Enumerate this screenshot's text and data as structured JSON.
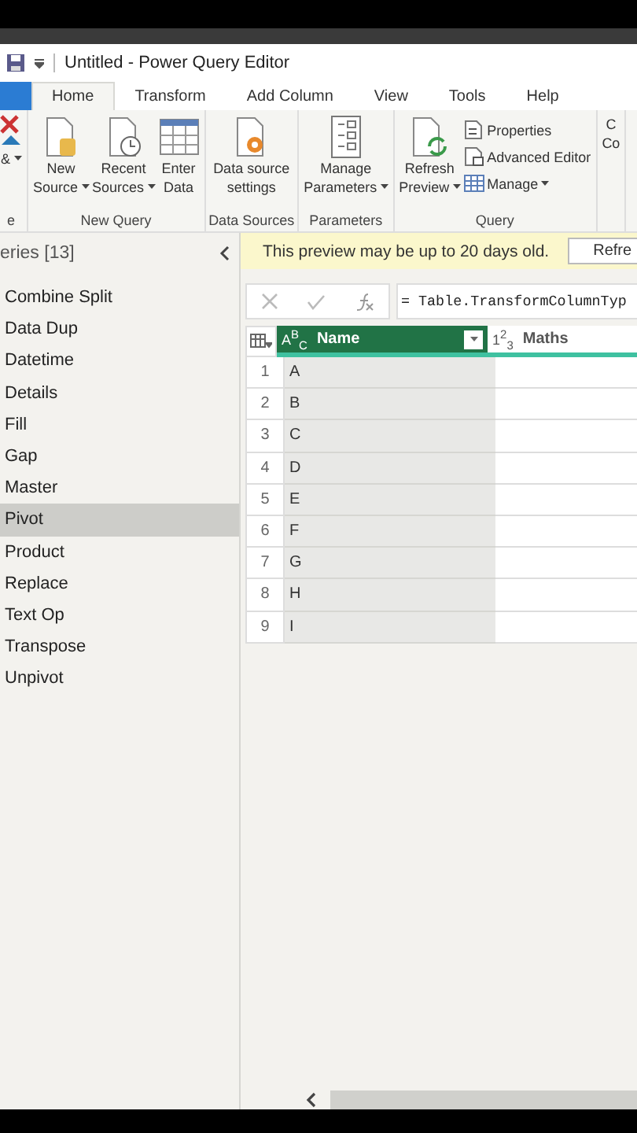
{
  "window": {
    "title": "Untitled - Power Query Editor"
  },
  "tabs": [
    {
      "label": "Home",
      "selected": true
    },
    {
      "label": "Transform",
      "selected": false
    },
    {
      "label": "Add Column",
      "selected": false
    },
    {
      "label": "View",
      "selected": false
    },
    {
      "label": "Tools",
      "selected": false
    },
    {
      "label": "Help",
      "selected": false
    }
  ],
  "ribbon": [
    {
      "label": "e",
      "buttons": [
        {
          "kind": "large",
          "lines": [
            "&"
          ],
          "dropdown": true
        }
      ]
    },
    {
      "label": "New Query",
      "buttons": [
        {
          "kind": "large",
          "lines": [
            "New",
            "Source"
          ],
          "dropdown": true
        },
        {
          "kind": "large",
          "lines": [
            "Recent",
            "Sources"
          ],
          "dropdown": true
        },
        {
          "kind": "large",
          "lines": [
            "Enter",
            "Data"
          ],
          "dropdown": false
        }
      ]
    },
    {
      "label": "Data Sources",
      "buttons": [
        {
          "kind": "large",
          "lines": [
            "Data source",
            "settings"
          ],
          "dropdown": false
        }
      ]
    },
    {
      "label": "Parameters",
      "buttons": [
        {
          "kind": "large",
          "lines": [
            "Manage",
            "Parameters"
          ],
          "dropdown": true
        }
      ]
    },
    {
      "label": "Query",
      "buttons": [
        {
          "kind": "large",
          "lines": [
            "Refresh",
            "Preview"
          ],
          "dropdown": true
        },
        {
          "kind": "small",
          "lines": [
            "Properties"
          ],
          "dropdown": false
        },
        {
          "kind": "small",
          "lines": [
            "Advanced Editor"
          ],
          "dropdown": false
        },
        {
          "kind": "small",
          "lines": [
            "Manage"
          ],
          "dropdown": true
        }
      ]
    },
    {
      "buttons": [
        {
          "kind": "large",
          "lines": [
            "C",
            "Co"
          ],
          "dropdown": false
        }
      ]
    }
  ],
  "sidebar": {
    "title": "eries [13]",
    "items": [
      {
        "label": "Combine Split",
        "selected": false
      },
      {
        "label": "Data Dup",
        "selected": false
      },
      {
        "label": "Datetime",
        "selected": false
      },
      {
        "label": "Details",
        "selected": false
      },
      {
        "label": "Fill",
        "selected": false
      },
      {
        "label": "Gap",
        "selected": false
      },
      {
        "label": "Master",
        "selected": false
      },
      {
        "label": "Pivot",
        "selected": true
      },
      {
        "label": "Product",
        "selected": false
      },
      {
        "label": "Replace",
        "selected": false
      },
      {
        "label": "Text Op",
        "selected": false
      },
      {
        "label": "Transpose",
        "selected": false
      },
      {
        "label": "Unpivot",
        "selected": false
      }
    ]
  },
  "info_bar": {
    "message": "This preview may be up to 20 days old.",
    "button": "Refre"
  },
  "formula_bar": {
    "formula": "= Table.TransformColumnTyp"
  },
  "table": {
    "columns": [
      {
        "type": "A$^{B}$$_{C}$",
        "name": "Name",
        "selected": true
      },
      {
        "type": "1$^{2}$$_{3}$",
        "name": "Maths",
        "selected": false
      }
    ],
    "rows": [
      {
        "index": "1",
        "name": "A"
      },
      {
        "index": "2",
        "name": "B"
      },
      {
        "index": "3",
        "name": "C"
      },
      {
        "index": "4",
        "name": "D"
      },
      {
        "index": "5",
        "name": "E"
      },
      {
        "index": "6",
        "name": "F"
      },
      {
        "index": "7",
        "name": "G"
      },
      {
        "index": "8",
        "name": "H"
      },
      {
        "index": "9",
        "name": "I"
      }
    ]
  }
}
